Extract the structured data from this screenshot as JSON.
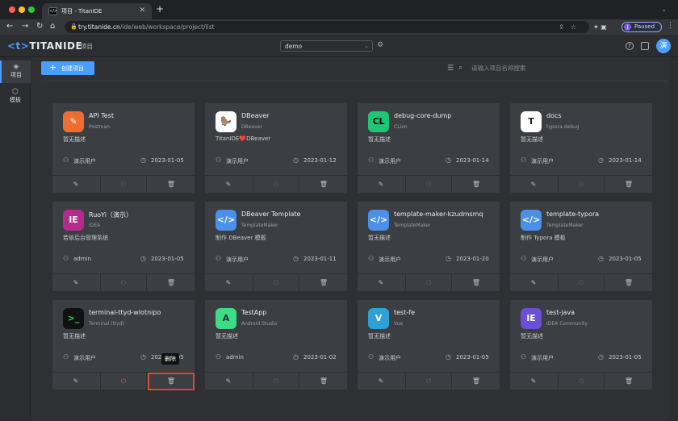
{
  "browser": {
    "tab_title": "项目 - TitanIDE",
    "tab_favicon": "</>",
    "url_host": "try.titanide.cn",
    "url_path": "/ide/web/workspace/project/list",
    "profile_initial": "J",
    "profile_status": "Paused",
    "traffic_colors": [
      "#ff5f57",
      "#febc2e",
      "#28c840"
    ]
  },
  "header": {
    "logo_bracket": "<t>",
    "logo_text": "TITANIDE",
    "nav_project": "项目",
    "workspace": "demo",
    "avatar_initial": "演"
  },
  "sidebar": {
    "items": [
      {
        "label": "项目",
        "icon": "layers-icon",
        "active": true
      },
      {
        "label": "模板",
        "icon": "cube-icon",
        "active": false
      }
    ]
  },
  "toolbar": {
    "create_label": "创建项目",
    "search_placeholder": "请输入项目名称搜索"
  },
  "tooltip": "删除",
  "cards": [
    {
      "title": "API Test",
      "sub": "Postman",
      "desc": "暂无描述",
      "user": "演示用户",
      "date": "2023-01-05",
      "logo": "✎",
      "logo_bg": "#ef6c35",
      "logo_fg": "#ffffff"
    },
    {
      "title": "DBeaver",
      "sub": "DBeaver",
      "desc": "TitanIDE❤️DBeaver",
      "user": "演示用户",
      "date": "2023-01-12",
      "logo": "🦫",
      "logo_bg": "#ffffff",
      "logo_fg": "#5a3a22"
    },
    {
      "title": "debug-core-dump",
      "sub": "CLion",
      "desc": "暂无描述",
      "user": "演示用户",
      "date": "2023-01-14",
      "logo": "CL",
      "logo_bg": "#1ec776",
      "logo_fg": "#000000"
    },
    {
      "title": "docs",
      "sub": "typora-debug",
      "desc": "暂无描述",
      "user": "演示用户",
      "date": "2023-01-14",
      "logo": "T",
      "logo_bg": "#ffffff",
      "logo_fg": "#222222"
    },
    {
      "title": "RuoYi（演示）",
      "sub": "IDEA",
      "desc": "若依后台管理系统",
      "user": "admin",
      "date": "2023-01-05",
      "logo": "IE",
      "logo_bg": "#b72a8a",
      "logo_fg": "#ffffff"
    },
    {
      "title": "DBeaver Template",
      "sub": "TemplateMaker",
      "desc": "制作 DBeaver 模板",
      "user": "演示用户",
      "date": "2023-01-11",
      "logo": "</>",
      "logo_bg": "#4a8fe8",
      "logo_fg": "#ffffff"
    },
    {
      "title": "template-maker-kzudmsmq",
      "sub": "TemplateMaker",
      "desc": "暂无描述",
      "user": "演示用户",
      "date": "2023-01-20",
      "logo": "</>",
      "logo_bg": "#4a8fe8",
      "logo_fg": "#ffffff"
    },
    {
      "title": "template-typora",
      "sub": "TemplateMaker",
      "desc": "制作 Typora 模板",
      "user": "演示用户",
      "date": "2023-01-05",
      "logo": "</>",
      "logo_bg": "#4a8fe8",
      "logo_fg": "#ffffff"
    },
    {
      "title": "terminal-ttyd-wlotnipo",
      "sub": "Terminal (ttyd)",
      "desc": "暂无描述",
      "user": "演示用户",
      "date": "2023-01-05",
      "logo": ">_",
      "logo_bg": "#111111",
      "logo_fg": "#35d06a"
    },
    {
      "title": "TestApp",
      "sub": "Android Studio",
      "desc": "暂无描述",
      "user": "admin",
      "date": "2023-01-02",
      "logo": "A",
      "logo_bg": "#3ddc84",
      "logo_fg": "#16324f"
    },
    {
      "title": "test-fe",
      "sub": "Vue",
      "desc": "暂无描述",
      "user": "演示用户",
      "date": "2023-01-05",
      "logo": "V",
      "logo_bg": "#2f9fd7",
      "logo_fg": "#ffffff"
    },
    {
      "title": "test-java",
      "sub": "IDEA Community",
      "desc": "暂无描述",
      "user": "演示用户",
      "date": "2023-01-05",
      "logo": "IE",
      "logo_bg": "#6b4fd8",
      "logo_fg": "#ffffff"
    }
  ]
}
